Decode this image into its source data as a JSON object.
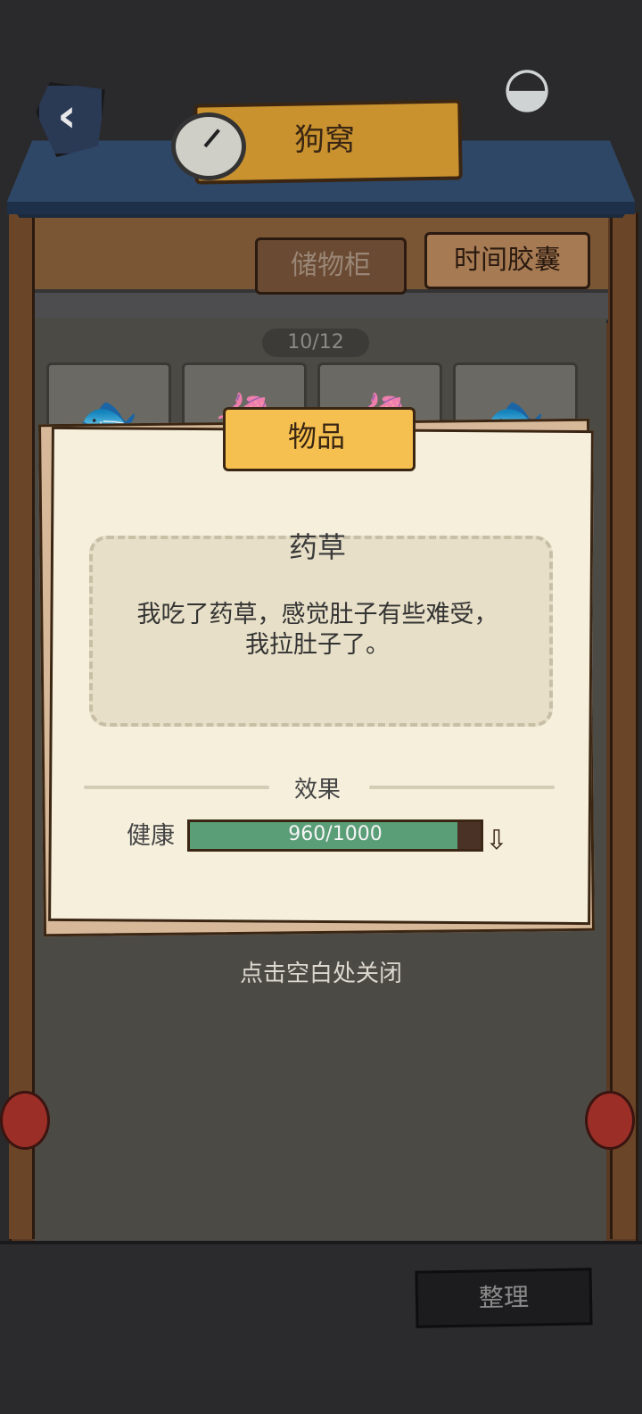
{
  "header": {
    "title": "狗窝"
  },
  "tabs": [
    {
      "label": "储物柜",
      "active": false
    },
    {
      "label": "时间胶囊",
      "active": true
    }
  ],
  "storage": {
    "count": "10/12",
    "slots": [
      {
        "icon": "eel-fish-icon"
      },
      {
        "icon": "seahorse-icon"
      },
      {
        "icon": "seahorse-icon"
      },
      {
        "icon": "eel-fish-icon"
      }
    ]
  },
  "popup": {
    "ribbon_title": "物品",
    "item_name": "药草",
    "description": "我吃了药草，感觉肚子有些难受，我拉肚子了。",
    "effect_label": "效果",
    "stat_label": "健康",
    "stat_value": "960/1000",
    "stat_fraction": 0.96,
    "stat_trend": "down-arrow-icon"
  },
  "close_hint": "点击空白处关闭",
  "tidy_button": "整理",
  "colors": {
    "health_bar": "#5a9e78",
    "ribbon": "#f5c04f",
    "paper": "#f5efdc",
    "roof": "#2f4766"
  }
}
